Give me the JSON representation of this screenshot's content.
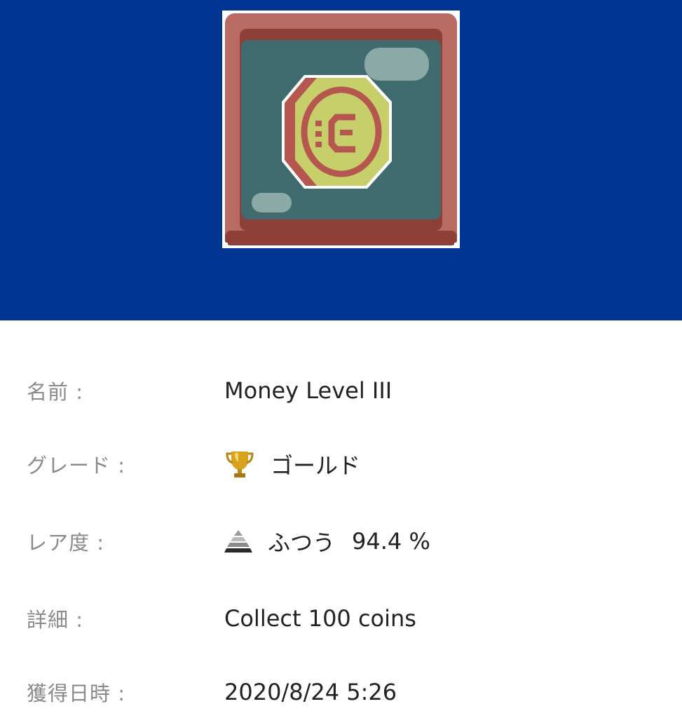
{
  "colors": {
    "banner": "#003594",
    "label": "#8a8a8a",
    "value": "#222222"
  },
  "badge": {
    "icon": "coin-badge-icon"
  },
  "rows": {
    "name": {
      "label": "名前 :",
      "value": "Money Level III"
    },
    "grade": {
      "label": "グレード :",
      "icon": "trophy-icon",
      "value": "ゴールド"
    },
    "rarity": {
      "label": "レア度 :",
      "icon": "pyramid-icon",
      "value": "ふつう",
      "percent": "94.4 %"
    },
    "detail": {
      "label": "詳細 :",
      "value": "Collect 100 coins"
    },
    "acquired": {
      "label": "獲得日時 :",
      "value": "2020/8/24 5:26"
    }
  }
}
